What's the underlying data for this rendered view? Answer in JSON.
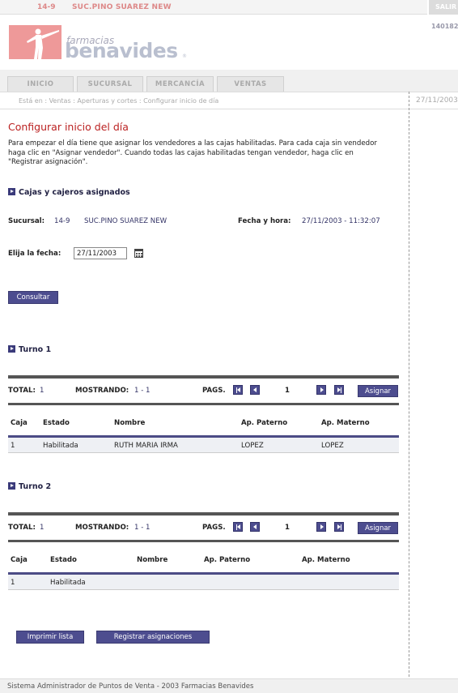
{
  "topbar": {
    "code": "14-9",
    "branch": "SUC.PINO SUAREZ NEW",
    "salir": "SALIR",
    "num": "140182"
  },
  "logo": {
    "farmacias": "farmacias",
    "benavides": "benavides",
    "reg": "®"
  },
  "tabs": [
    "INICIO",
    "SUCURSAL",
    "MERCANCÍA",
    "VENTAS"
  ],
  "breadcrumb": {
    "path": "Está en : Ventas : Aperturas y cortes : Configurar inicio de día",
    "date": "27/11/2003"
  },
  "page": {
    "title": "Configurar inicio del día",
    "intro": "Para empezar el día tiene que asignar los vendedores a las cajas habilitadas. Para cada caja sin vendedor haga clic en \"Asignar vendedor\". Cuando todas las cajas habilitadas tengan vendedor, haga clic en \"Registrar asignación\".",
    "section": "Cajas y cajeros asignados",
    "sucursal_label": "Sucursal:",
    "sucursal_code": "14-9",
    "sucursal_name": "SUC.PINO SUAREZ NEW",
    "fecha_label": "Fecha y hora:",
    "fecha_value": "27/11/2003 - 11:32:07",
    "elija_label": "Elija la fecha:",
    "date_value": "27/11/2003",
    "consultar": "Consultar"
  },
  "turnos": [
    {
      "title": "Turno 1",
      "total_label": "TOTAL:",
      "total": "1",
      "mostrando_label": "MOSTRANDO:",
      "mostrando": "1 - 1",
      "pags_label": "PAGS.",
      "page": "1",
      "asignar": "Asignar",
      "headers": [
        "Caja",
        "Estado",
        "Nombre",
        "Ap. Paterno",
        "Ap. Materno"
      ],
      "rows": [
        [
          "1",
          "Habilitada",
          "RUTH MARIA IRMA",
          "LOPEZ",
          "LOPEZ"
        ]
      ]
    },
    {
      "title": "Turno 2",
      "total_label": "TOTAL:",
      "total": "1",
      "mostrando_label": "MOSTRANDO:",
      "mostrando": "1 - 1",
      "pags_label": "PAGS.",
      "page": "1",
      "asignar": "Asignar",
      "headers": [
        "Caja",
        "Estado",
        "Nombre",
        "Ap. Paterno",
        "Ap. Materno"
      ],
      "rows": [
        [
          "1",
          "Habilitada",
          "",
          "",
          ""
        ]
      ]
    }
  ],
  "actions": {
    "imprimir": "Imprimir lista",
    "registrar": "Registrar asignaciones"
  },
  "footer": "Sistema Administrador de Puntos de Venta - 2003 Farmacias Benavides",
  "colors": {
    "accent": "#4d4d8f",
    "title": "#bb2222",
    "logo": "#ee9999"
  }
}
